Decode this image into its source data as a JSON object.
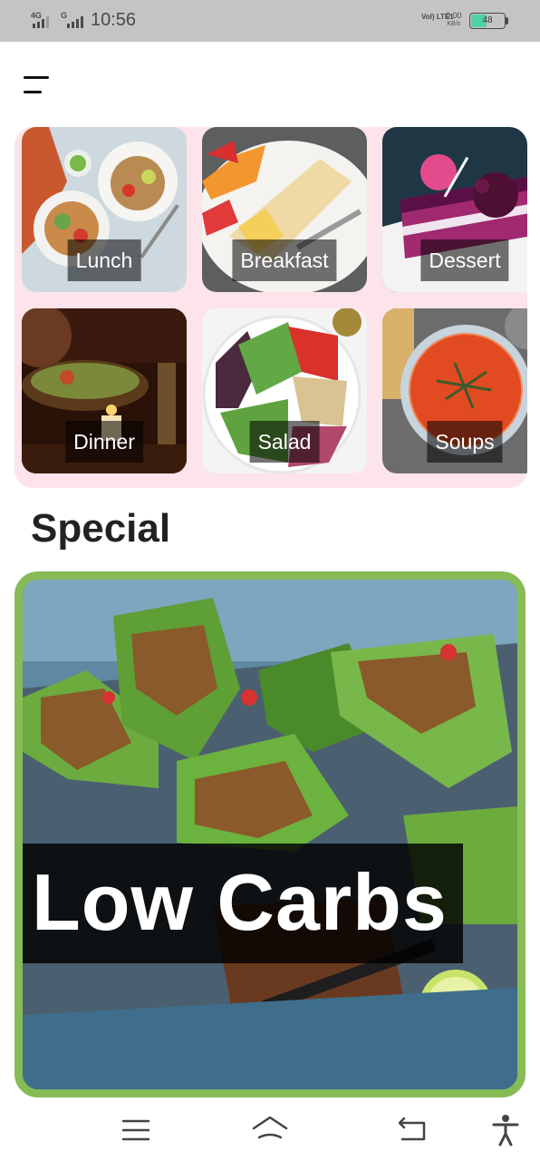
{
  "status_bar": {
    "network1": "4G",
    "network2": "G",
    "time": "10:56",
    "volte": "Vol) LTE1",
    "speed_value": "0.00",
    "speed_unit": "KB/s",
    "battery_level": "48",
    "battery_color": "#4fd1a5"
  },
  "header": {
    "menu_icon": "hamburger-menu-icon"
  },
  "categories": [
    {
      "label": "Lunch"
    },
    {
      "label": "Breakfast"
    },
    {
      "label": "Dessert"
    },
    {
      "label": "Dinner"
    },
    {
      "label": "Salad"
    },
    {
      "label": "Soups"
    }
  ],
  "special": {
    "heading": "Special",
    "title": "Low Carbs",
    "border_color": "#86bb56"
  },
  "nav": {
    "items": [
      "menu-icon",
      "home-icon",
      "back-icon",
      "accessibility-icon"
    ]
  },
  "colors": {
    "category_panel": "#fde3ea",
    "status_bar": "#c4c4c4"
  }
}
